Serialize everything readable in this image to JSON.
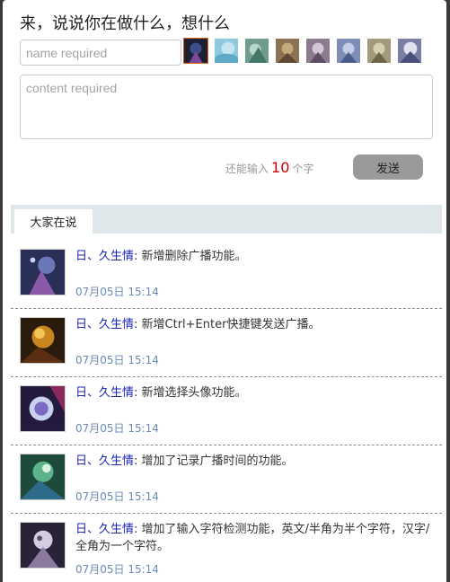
{
  "composer": {
    "heading": "来，说说你在做什么，想什么",
    "name_placeholder": "name required",
    "content_placeholder": "content required",
    "counter_prefix": "还能输入",
    "counter_value": "10",
    "counter_suffix": "个字",
    "send_label": "发送",
    "avatar_count": 8,
    "selected_avatar": 0
  },
  "tabs": {
    "active": "大家在说"
  },
  "feed": [
    {
      "user": "日、久生情",
      "sep": ": ",
      "text": "新增删除广播功能。",
      "time": "07月05日 15:14"
    },
    {
      "user": "日、久生情",
      "sep": ": ",
      "text": "新增Ctrl+Enter快捷键发送广播。",
      "time": "07月05日 15:14"
    },
    {
      "user": "日、久生情",
      "sep": ": ",
      "text": "新增选择头像功能。",
      "time": "07月05日 15:14"
    },
    {
      "user": "日、久生情",
      "sep": ": ",
      "text": "增加了记录广播时间的功能。",
      "time": "07月05日 15:14"
    },
    {
      "user": "日、久生情",
      "sep": ": ",
      "text": "增加了输入字符检测功能，英文/半角为半个字符，汉字/全角为一个字符。",
      "time": "07月05日 15:14"
    }
  ]
}
